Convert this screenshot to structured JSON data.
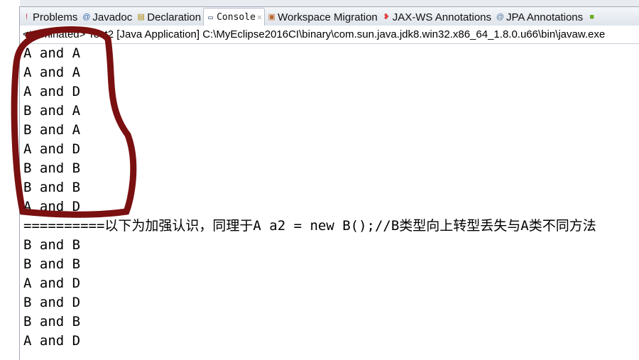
{
  "tabs": [
    {
      "label": "Problems",
      "icon": "problems-icon",
      "active": false
    },
    {
      "label": "Javadoc",
      "icon": "at-icon",
      "active": false
    },
    {
      "label": "Declaration",
      "icon": "declaration-icon",
      "active": false
    },
    {
      "label": "Console",
      "icon": "console-icon",
      "active": true
    },
    {
      "label": "Workspace Migration",
      "icon": "migration-icon",
      "active": false
    },
    {
      "label": "JAX-WS Annotations",
      "icon": "jaxws-icon",
      "active": false
    },
    {
      "label": "JPA Annotations",
      "icon": "jpa-icon",
      "active": false
    }
  ],
  "status": "<terminated> Test2 [Java Application] C:\\MyEclipse2016CI\\binary\\com.sun.java.jdk8.win32.x86_64_1.8.0.u66\\bin\\javaw.exe",
  "console_lines": [
    "A and A",
    "A and A",
    "A and D",
    "B and A",
    "B and A",
    "A and D",
    "B and B",
    "B and B",
    "A and D",
    "==========以下为加强认识，同理于A a2 = new B();//B类型向上转型丢失与A类不同方法",
    "B and B",
    "B and B",
    "A and D",
    "B and D",
    "B and B",
    "A and D"
  ],
  "annotation_color": "#7a1010"
}
